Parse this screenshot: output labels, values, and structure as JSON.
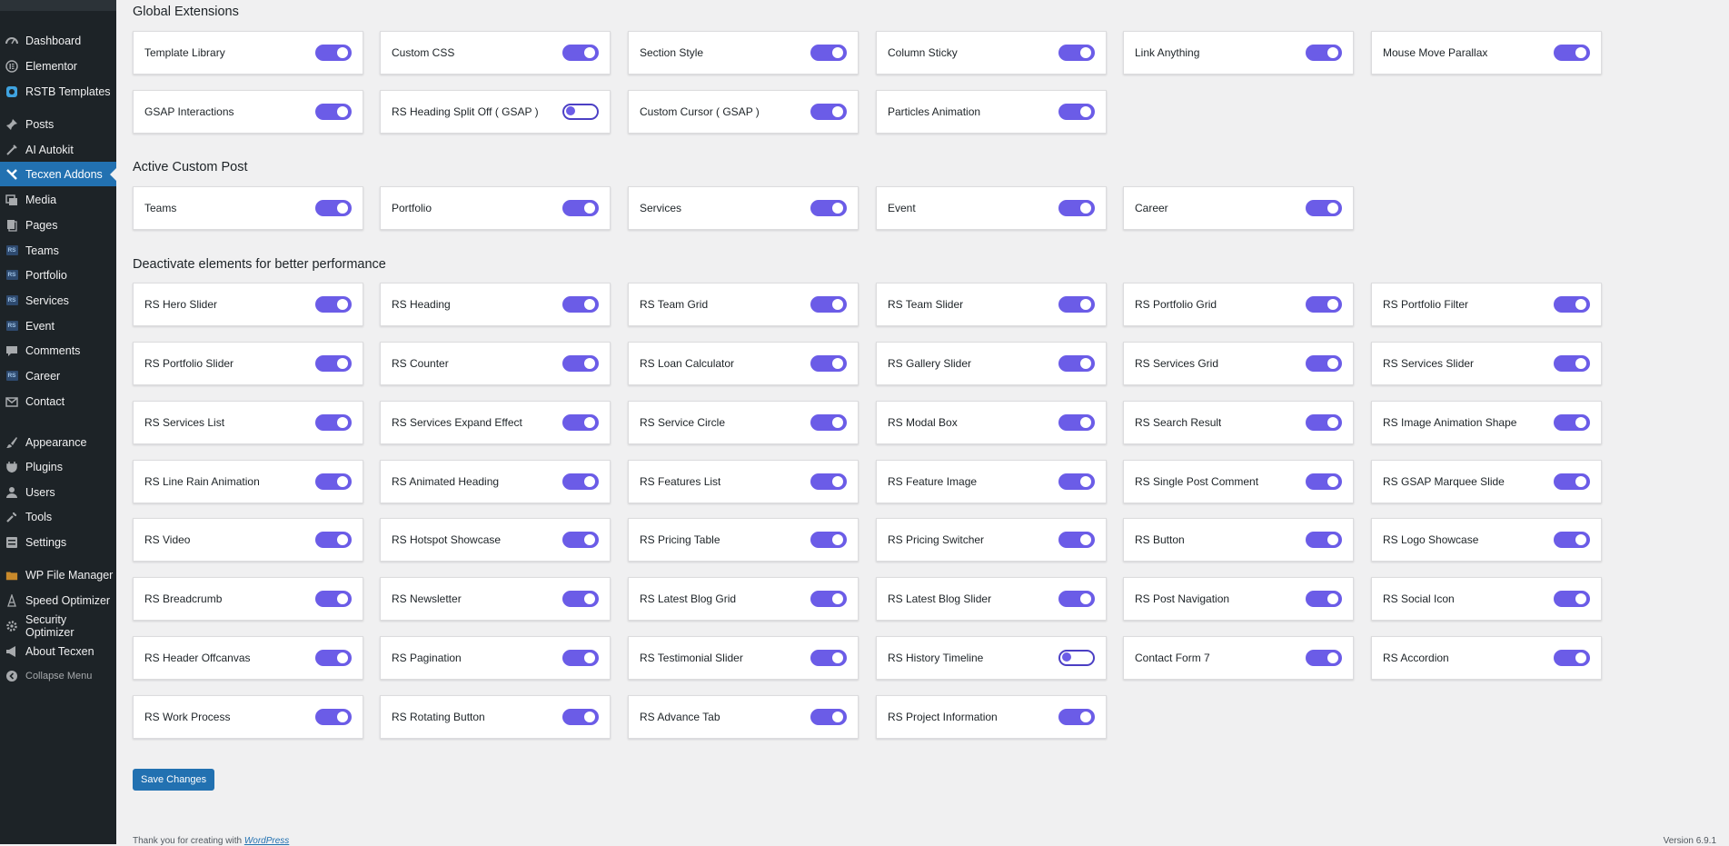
{
  "sidebar": {
    "items": [
      {
        "label": "Dashboard",
        "icon": "dashboard-icon"
      },
      {
        "label": "Elementor",
        "icon": "elementor-icon"
      },
      {
        "label": "RSTB Templates",
        "icon": "templates-icon"
      },
      {
        "label": "Posts",
        "icon": "pin-icon"
      },
      {
        "label": "AI Autokit",
        "icon": "ai-icon"
      },
      {
        "label": "Tecxen Addons",
        "icon": "tecxen-icon",
        "active": true
      },
      {
        "label": "Media",
        "icon": "media-icon"
      },
      {
        "label": "Pages",
        "icon": "pages-icon"
      },
      {
        "label": "Teams",
        "icon": "rs-icon"
      },
      {
        "label": "Portfolio",
        "icon": "rs-icon"
      },
      {
        "label": "Services",
        "icon": "rs-icon"
      },
      {
        "label": "Event",
        "icon": "rs-icon"
      },
      {
        "label": "Comments",
        "icon": "comments-icon"
      },
      {
        "label": "Career",
        "icon": "rs-icon"
      },
      {
        "label": "Contact",
        "icon": "mail-icon"
      },
      {
        "label": "Appearance",
        "icon": "brush-icon"
      },
      {
        "label": "Plugins",
        "icon": "plugin-icon"
      },
      {
        "label": "Users",
        "icon": "users-icon"
      },
      {
        "label": "Tools",
        "icon": "wrench-icon"
      },
      {
        "label": "Settings",
        "icon": "settings-icon"
      },
      {
        "label": "WP File Manager",
        "icon": "folder-icon"
      },
      {
        "label": "Speed Optimizer",
        "icon": "speed-icon"
      },
      {
        "label": "Security Optimizer",
        "icon": "gear-icon"
      },
      {
        "label": "About Tecxen",
        "icon": "megaphone-icon"
      },
      {
        "label": "Collapse Menu",
        "icon": "collapse-icon"
      }
    ]
  },
  "sections": [
    {
      "title": "Global Extensions",
      "items": [
        {
          "label": "Template Library",
          "on": true
        },
        {
          "label": "Custom CSS",
          "on": true
        },
        {
          "label": "Section Style",
          "on": true
        },
        {
          "label": "Column Sticky",
          "on": true
        },
        {
          "label": "Link Anything",
          "on": true
        },
        {
          "label": "Mouse Move Parallax",
          "on": true
        },
        {
          "label": "GSAP Interactions",
          "on": true
        },
        {
          "label": "RS Heading Split Off ( GSAP )",
          "on": false
        },
        {
          "label": "Custom Cursor ( GSAP )",
          "on": true
        },
        {
          "label": "Particles Animation",
          "on": true
        }
      ]
    },
    {
      "title": "Active Custom Post",
      "items": [
        {
          "label": "Teams",
          "on": true
        },
        {
          "label": "Portfolio",
          "on": true
        },
        {
          "label": "Services",
          "on": true
        },
        {
          "label": "Event",
          "on": true
        },
        {
          "label": "Career",
          "on": true
        }
      ]
    },
    {
      "title": "Deactivate elements for better performance",
      "items": [
        {
          "label": "RS Hero Slider",
          "on": true
        },
        {
          "label": "RS Heading",
          "on": true
        },
        {
          "label": "RS Team Grid",
          "on": true
        },
        {
          "label": "RS Team Slider",
          "on": true
        },
        {
          "label": "RS Portfolio Grid",
          "on": true
        },
        {
          "label": "RS Portfolio Filter",
          "on": true
        },
        {
          "label": "RS Portfolio Slider",
          "on": true
        },
        {
          "label": "RS Counter",
          "on": true
        },
        {
          "label": "RS Loan Calculator",
          "on": true
        },
        {
          "label": "RS Gallery Slider",
          "on": true
        },
        {
          "label": "RS Services Grid",
          "on": true
        },
        {
          "label": "RS Services Slider",
          "on": true
        },
        {
          "label": "RS Services List",
          "on": true
        },
        {
          "label": "RS Services Expand Effect",
          "on": true
        },
        {
          "label": "RS Service Circle",
          "on": true
        },
        {
          "label": "RS Modal Box",
          "on": true
        },
        {
          "label": "RS Search Result",
          "on": true
        },
        {
          "label": "RS Image Animation Shape",
          "on": true
        },
        {
          "label": "RS Line Rain Animation",
          "on": true
        },
        {
          "label": "RS Animated Heading",
          "on": true
        },
        {
          "label": "RS Features List",
          "on": true
        },
        {
          "label": "RS Feature Image",
          "on": true
        },
        {
          "label": "RS Single Post Comment",
          "on": true
        },
        {
          "label": "RS GSAP Marquee Slide",
          "on": true
        },
        {
          "label": "RS Video",
          "on": true
        },
        {
          "label": "RS Hotspot Showcase",
          "on": true
        },
        {
          "label": "RS Pricing Table",
          "on": true
        },
        {
          "label": "RS Pricing Switcher",
          "on": true
        },
        {
          "label": "RS Button",
          "on": true
        },
        {
          "label": "RS Logo Showcase",
          "on": true
        },
        {
          "label": "RS Breadcrumb",
          "on": true
        },
        {
          "label": "RS Newsletter",
          "on": true
        },
        {
          "label": "RS Latest Blog Grid",
          "on": true
        },
        {
          "label": "RS Latest Blog Slider",
          "on": true
        },
        {
          "label": "RS Post Navigation",
          "on": true
        },
        {
          "label": "RS Social Icon",
          "on": true
        },
        {
          "label": "RS Header Offcanvas",
          "on": true
        },
        {
          "label": "RS Pagination",
          "on": true
        },
        {
          "label": "RS Testimonial Slider",
          "on": true
        },
        {
          "label": "RS History Timeline",
          "on": false
        },
        {
          "label": "Contact Form 7",
          "on": true
        },
        {
          "label": "RS Accordion",
          "on": true
        },
        {
          "label": "RS Work Process",
          "on": true
        },
        {
          "label": "RS Rotating Button",
          "on": true
        },
        {
          "label": "RS Advance Tab",
          "on": true
        },
        {
          "label": "RS Project Information",
          "on": true
        }
      ]
    }
  ],
  "save_label": "Save Changes",
  "footer": {
    "text": "Thank you for creating with ",
    "link": "WordPress",
    "version": "Version 6.9.1"
  },
  "colors": {
    "toggle_on": "#6b5ce7",
    "accent": "#2271b1",
    "sidebar": "#1d2327"
  }
}
